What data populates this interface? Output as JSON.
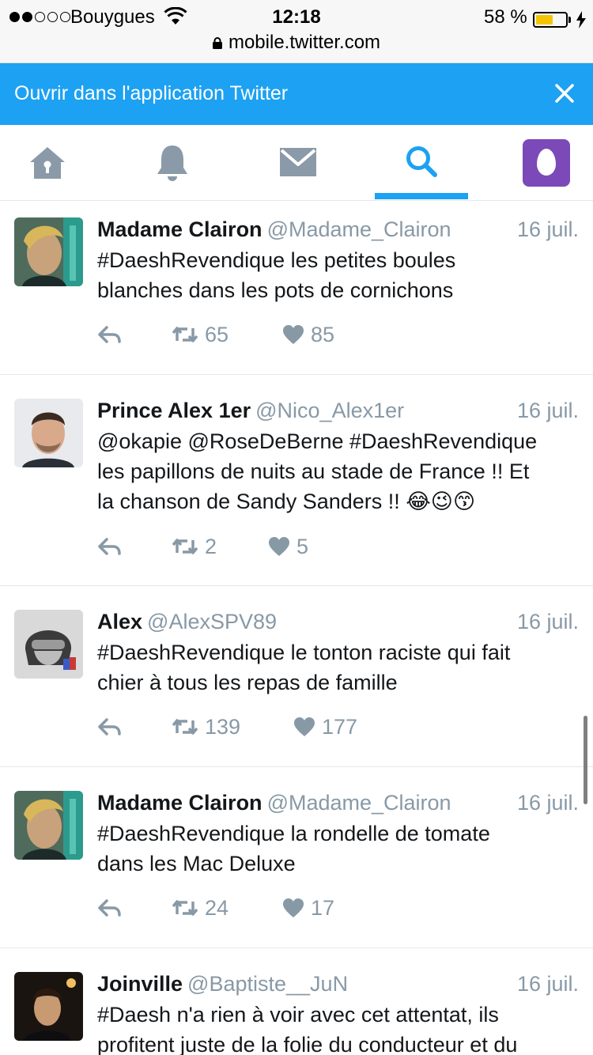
{
  "status": {
    "carrier": "Bouygues",
    "time": "12:18",
    "battery_pct": "58 %",
    "battery_level": 0.58,
    "url": "mobile.twitter.com"
  },
  "banner": {
    "text": "Ouvrir dans l'application Twitter",
    "color": "#1da1f2"
  },
  "tabs": [
    {
      "icon": "home-icon",
      "active": false
    },
    {
      "icon": "bell-icon",
      "active": false
    },
    {
      "icon": "envelope-icon",
      "active": false
    },
    {
      "icon": "search-icon",
      "active": true
    },
    {
      "icon": "profile-egg-icon",
      "active": false
    }
  ],
  "tweets": [
    {
      "name": "Madame Clairon",
      "handle": "@Madame_Clairon",
      "date": "16 juil.",
      "lines": [
        "#DaeshRevendique les petites boules",
        "blanches dans les pots de cornichons"
      ],
      "retweets": "65",
      "likes": "85"
    },
    {
      "name": "Prince Alex 1er",
      "handle": "@Nico_Alex1er",
      "date": "16 juil.",
      "lines": [
        "@okapie @RoseDeBerne #DaeshRevendique",
        "les papillons de nuits au stade de France !! Et",
        "la chanson de Sandy Sanders !! 😂😉😙"
      ],
      "retweets": "2",
      "likes": "5"
    },
    {
      "name": "Alex",
      "handle": "@AlexSPV89",
      "date": "16 juil.",
      "lines": [
        "#DaeshRevendique le tonton raciste qui fait",
        "chier à tous les repas de famille"
      ],
      "retweets": "139",
      "likes": "177"
    },
    {
      "name": "Madame Clairon",
      "handle": "@Madame_Clairon",
      "date": "16 juil.",
      "lines": [
        "#DaeshRevendique la rondelle de tomate",
        "dans les Mac Deluxe"
      ],
      "retweets": "24",
      "likes": "17"
    },
    {
      "name": "Joinville",
      "handle": "@Baptiste__JuN",
      "date": "16 juil.",
      "lines": [
        "#Daesh n'a rien à voir avec cet attentat, ils",
        "profitent juste de la folie du conducteur et du"
      ],
      "retweets": "",
      "likes": ""
    }
  ]
}
